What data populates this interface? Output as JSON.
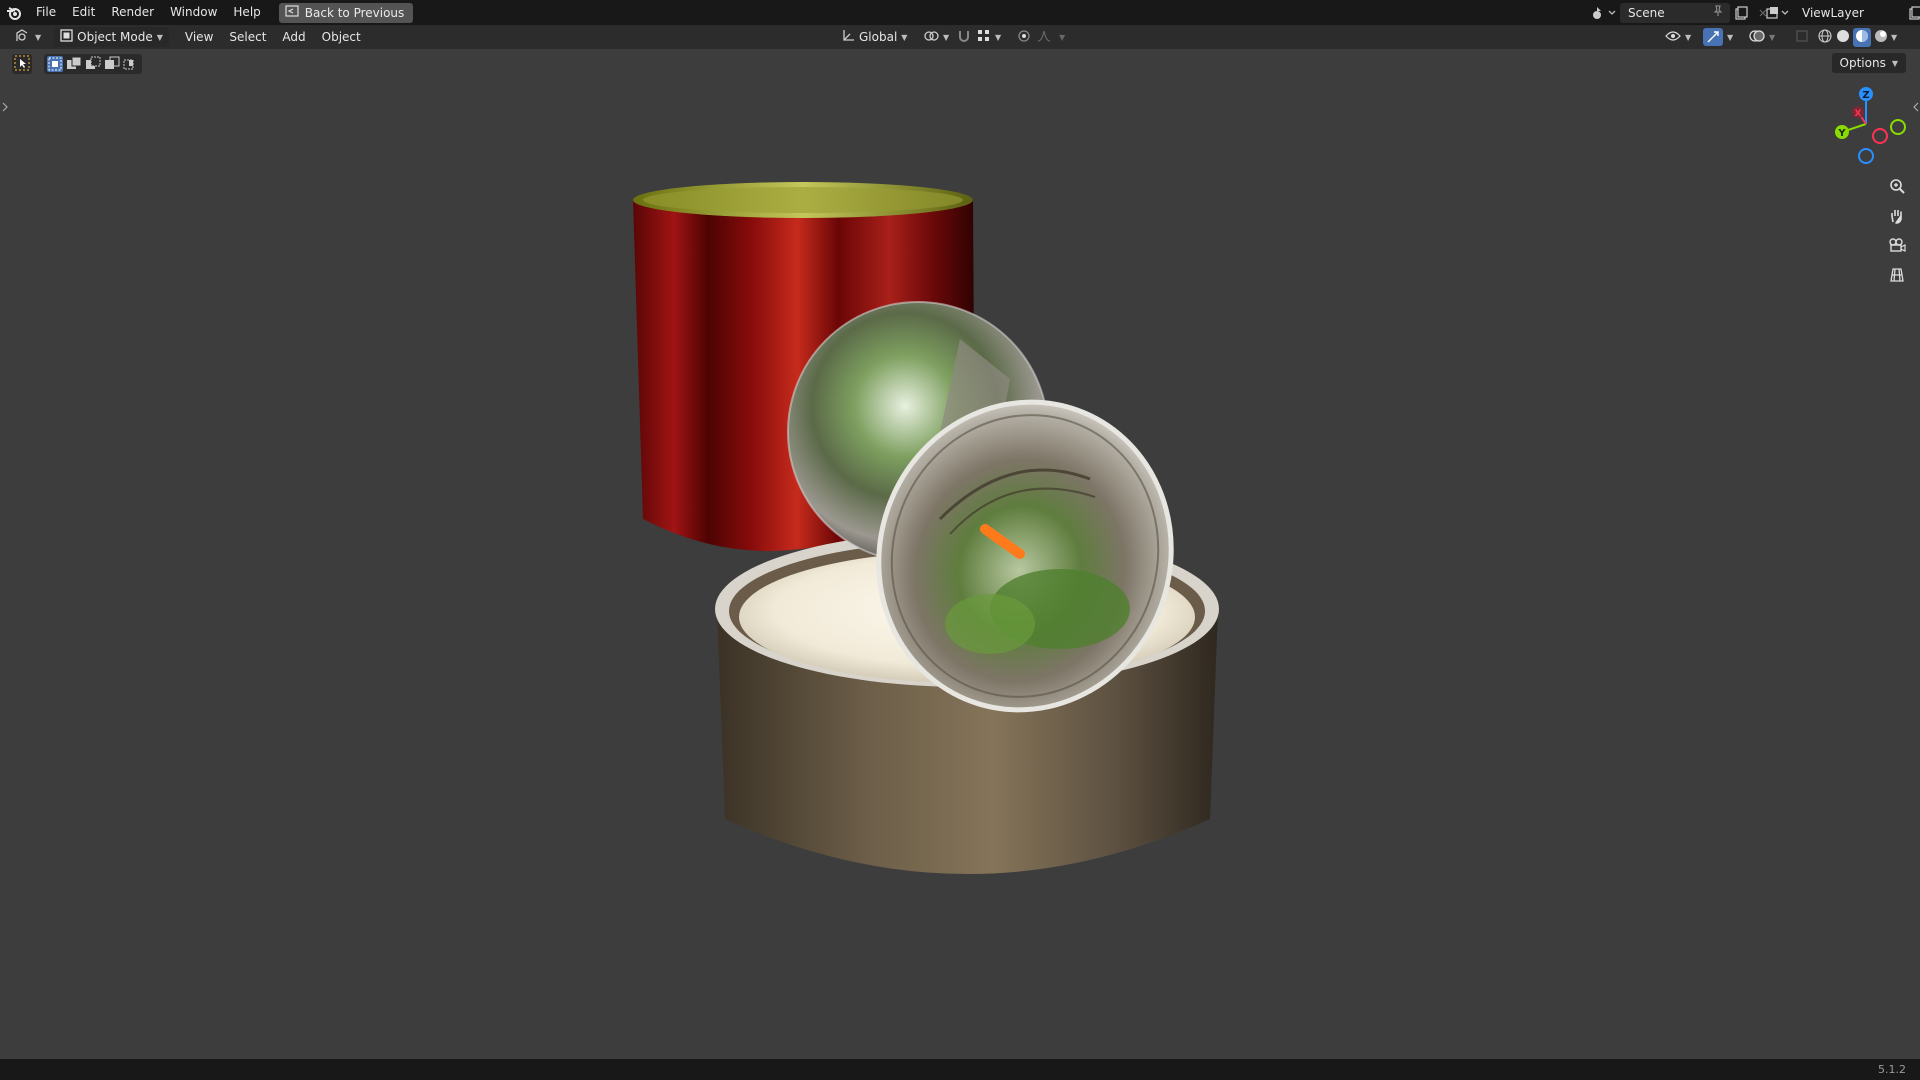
{
  "menu": {
    "items": [
      "File",
      "Edit",
      "Render",
      "Window",
      "Help"
    ],
    "back_label": "Back to Previous"
  },
  "top_right": {
    "scene": "Scene",
    "view_layer": "ViewLayer"
  },
  "viewport_header": {
    "mode": "Object Mode",
    "menus": [
      "View",
      "Select",
      "Add",
      "Object"
    ],
    "transform_orientation": "Global"
  },
  "options_label": "Options",
  "nav_gizmo": {
    "axes": [
      "X",
      "Y",
      "Z"
    ],
    "colors": {
      "x": "#ff3352",
      "y": "#8bdc00",
      "z": "#2890ff"
    }
  },
  "status": {
    "version": "5.1.2"
  },
  "icons": {
    "viewport_tools": [
      "zoom-icon",
      "hand-pan-icon",
      "camera-view-icon",
      "ortho-grid-icon"
    ],
    "shading_modes": [
      "wireframe",
      "solid",
      "material-preview",
      "rendered"
    ]
  }
}
